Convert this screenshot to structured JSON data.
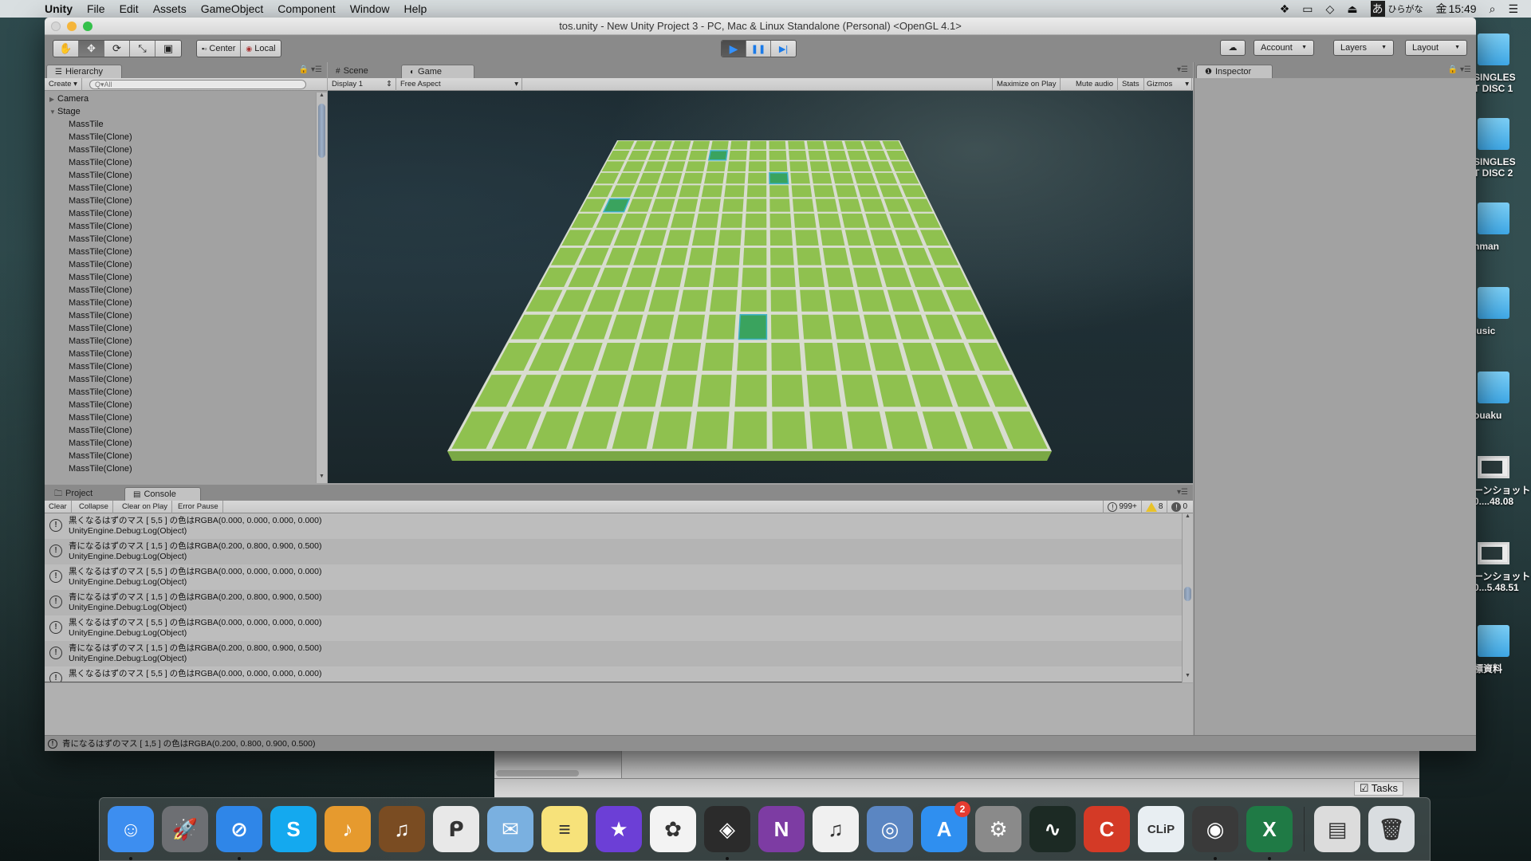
{
  "menubar": {
    "app_name": "Unity",
    "items": [
      "File",
      "Edit",
      "Assets",
      "GameObject",
      "Component",
      "Window",
      "Help"
    ],
    "status": {
      "input_method_glyph": "あ",
      "input_method_label": "ひらがな",
      "day": "金",
      "time": "15:49"
    }
  },
  "window": {
    "title": "tos.unity - New Unity Project 3 - PC, Mac & Linux Standalone (Personal) <OpenGL 4.1>"
  },
  "toolbar": {
    "transform_tools": [
      {
        "name": "hand-tool",
        "glyph": "✋",
        "active": false
      },
      {
        "name": "move-tool",
        "glyph": "✥",
        "active": true
      },
      {
        "name": "rotate-tool",
        "glyph": "⟳",
        "active": false
      },
      {
        "name": "scale-tool",
        "glyph": "⤡",
        "active": false
      },
      {
        "name": "rect-tool",
        "glyph": "▣",
        "active": false
      }
    ],
    "pivot_center_label": "Center",
    "pivot_local_label": "Local",
    "play_glyph": "▶",
    "pause_glyph": "❚❚",
    "step_glyph": "▶|",
    "cloud_glyph": "☁",
    "account_label": "Account",
    "layers_label": "Layers",
    "layout_label": "Layout"
  },
  "hierarchy": {
    "tab_label": "Hierarchy",
    "create_label": "Create",
    "search_placeholder": "Q▾All",
    "items": [
      {
        "label": "Camera",
        "expander": "▶",
        "level": 0
      },
      {
        "label": "Stage",
        "expander": "▼",
        "level": 0
      },
      {
        "label": "MassTile",
        "level": 1
      },
      {
        "label": "MassTile(Clone)",
        "level": 1
      },
      {
        "label": "MassTile(Clone)",
        "level": 1
      },
      {
        "label": "MassTile(Clone)",
        "level": 1
      },
      {
        "label": "MassTile(Clone)",
        "level": 1
      },
      {
        "label": "MassTile(Clone)",
        "level": 1
      },
      {
        "label": "MassTile(Clone)",
        "level": 1
      },
      {
        "label": "MassTile(Clone)",
        "level": 1
      },
      {
        "label": "MassTile(Clone)",
        "level": 1
      },
      {
        "label": "MassTile(Clone)",
        "level": 1
      },
      {
        "label": "MassTile(Clone)",
        "level": 1
      },
      {
        "label": "MassTile(Clone)",
        "level": 1
      },
      {
        "label": "MassTile(Clone)",
        "level": 1
      },
      {
        "label": "MassTile(Clone)",
        "level": 1
      },
      {
        "label": "MassTile(Clone)",
        "level": 1
      },
      {
        "label": "MassTile(Clone)",
        "level": 1
      },
      {
        "label": "MassTile(Clone)",
        "level": 1
      },
      {
        "label": "MassTile(Clone)",
        "level": 1
      },
      {
        "label": "MassTile(Clone)",
        "level": 1
      },
      {
        "label": "MassTile(Clone)",
        "level": 1
      },
      {
        "label": "MassTile(Clone)",
        "level": 1
      },
      {
        "label": "MassTile(Clone)",
        "level": 1
      },
      {
        "label": "MassTile(Clone)",
        "level": 1
      },
      {
        "label": "MassTile(Clone)",
        "level": 1
      },
      {
        "label": "MassTile(Clone)",
        "level": 1
      },
      {
        "label": "MassTile(Clone)",
        "level": 1
      },
      {
        "label": "MassTile(Clone)",
        "level": 1
      },
      {
        "label": "MassTile(Clone)",
        "level": 1
      }
    ]
  },
  "game_view": {
    "tabs": [
      {
        "label": "Scene",
        "icon": "#",
        "active": false
      },
      {
        "label": "Game",
        "icon": "◐",
        "active": true
      }
    ],
    "display_label": "Display 1",
    "aspect_label": "Free Aspect",
    "options": [
      "Maximize on Play",
      "Mute audio",
      "Stats",
      "Gizmos"
    ],
    "board": {
      "columns": 15,
      "rows": 15,
      "tile_color": "#8fc14f",
      "line_color": "#d9ddd0",
      "highlight_color": "#3aa35e",
      "highlight_border": "#3cb3c9",
      "highlighted_cells": [
        {
          "row": 1,
          "col": 5
        },
        {
          "row": 3,
          "col": 8
        },
        {
          "row": 5,
          "col": 1
        },
        {
          "row": 11,
          "col": 7
        }
      ]
    }
  },
  "inspector": {
    "tab_label": "Inspector"
  },
  "console": {
    "tabs": [
      {
        "label": "Project",
        "active": false
      },
      {
        "label": "Console",
        "active": true
      }
    ],
    "buttons": [
      "Clear",
      "Collapse",
      "Clear on Play",
      "Error Pause"
    ],
    "log_count": "999+",
    "warning_count": "8",
    "error_count": "0",
    "entries": [
      {
        "message": "黒くなるはずのマス [ 5,5 ] の色はRGBA(0.000, 0.000, 0.000, 0.000)",
        "trace": "UnityEngine.Debug:Log(Object)"
      },
      {
        "message": "青になるはずのマス [ 1,5 ] の色はRGBA(0.200, 0.800, 0.900, 0.500)",
        "trace": "UnityEngine.Debug:Log(Object)"
      },
      {
        "message": "黒くなるはずのマス [ 5,5 ] の色はRGBA(0.000, 0.000, 0.000, 0.000)",
        "trace": "UnityEngine.Debug:Log(Object)"
      },
      {
        "message": "青になるはずのマス [ 1,5 ] の色はRGBA(0.200, 0.800, 0.900, 0.500)",
        "trace": "UnityEngine.Debug:Log(Object)"
      },
      {
        "message": "黒くなるはずのマス [ 5,5 ] の色はRGBA(0.000, 0.000, 0.000, 0.000)",
        "trace": "UnityEngine.Debug:Log(Object)"
      },
      {
        "message": "青になるはずのマス [ 1,5 ] の色はRGBA(0.200, 0.800, 0.900, 0.500)",
        "trace": "UnityEngine.Debug:Log(Object)"
      },
      {
        "message": "黒くなるはずのマス [ 5,5 ] の色はRGBA(0.000, 0.000, 0.000, 0.000)",
        "trace": ""
      }
    ]
  },
  "status_bar": {
    "message": "青になるはずのマス [ 1,5 ] の色はRGBA(0.200, 0.800, 0.900, 0.500)"
  },
  "background_window": {
    "tasks_label": "Tasks"
  },
  "desktop": {
    "items": [
      {
        "label": "SINGLES\nT DISC 1",
        "type": "folder"
      },
      {
        "label": "SINGLES\nT DISC 2",
        "type": "folder"
      },
      {
        "label": "nman",
        "type": "folder"
      },
      {
        "label": "lusic",
        "type": "folder"
      },
      {
        "label": "ouaku",
        "type": "folder"
      },
      {
        "label": "ーンショット\n0....48.08",
        "type": "screenshot"
      },
      {
        "label": "ーンショット\n0...5.48.51",
        "type": "screenshot"
      },
      {
        "label": "標資料",
        "type": "folder"
      }
    ]
  },
  "dock": {
    "apps": [
      {
        "name": "finder",
        "glyph": "☺",
        "bg": "#3d8ef0",
        "running": true
      },
      {
        "name": "launchpad",
        "glyph": "🚀",
        "bg": "#6d6f73",
        "running": false
      },
      {
        "name": "safari",
        "glyph": "⊘",
        "bg": "#2f86e8",
        "running": true
      },
      {
        "name": "skype",
        "glyph": "S",
        "bg": "#14a9ef",
        "running": false
      },
      {
        "name": "mainstage",
        "glyph": "♪",
        "bg": "#e69a2e",
        "running": false
      },
      {
        "name": "garageband",
        "glyph": "♫",
        "bg": "#7a4c22",
        "running": false
      },
      {
        "name": "clip-studio",
        "glyph": "ᑭ",
        "bg": "#e8e8e8",
        "running": false
      },
      {
        "name": "mail",
        "glyph": "✉",
        "bg": "#7ab0e0",
        "running": false
      },
      {
        "name": "notes",
        "glyph": "≡",
        "bg": "#f7e27a",
        "running": false
      },
      {
        "name": "imovie",
        "glyph": "★",
        "bg": "#6c3fd6",
        "running": false
      },
      {
        "name": "photos",
        "glyph": "✿",
        "bg": "#f3f3f3",
        "running": false
      },
      {
        "name": "unity",
        "glyph": "◈",
        "bg": "#2b2b2b",
        "running": true
      },
      {
        "name": "onenote",
        "glyph": "N",
        "bg": "#7d3ca3",
        "running": false
      },
      {
        "name": "itunes",
        "glyph": "♫",
        "bg": "#f0f0f0",
        "running": false
      },
      {
        "name": "monodevelop",
        "glyph": "◎",
        "bg": "#5b86c2",
        "running": false
      },
      {
        "name": "app-store",
        "glyph": "A",
        "bg": "#2f8ff0",
        "running": false,
        "badge": "2"
      },
      {
        "name": "system-preferences",
        "glyph": "⚙",
        "bg": "#8a8a8a",
        "running": false
      },
      {
        "name": "activity-monitor",
        "glyph": "∿",
        "bg": "#1c2a24",
        "running": false
      },
      {
        "name": "ccleaner",
        "glyph": "C",
        "bg": "#d43a26",
        "running": false
      },
      {
        "name": "clip",
        "glyph": "CLiP",
        "bg": "#e8eef2",
        "running": false
      },
      {
        "name": "wacom",
        "glyph": "◉",
        "bg": "#3a3a3a",
        "running": true
      },
      {
        "name": "excel",
        "glyph": "X",
        "bg": "#1f7a45",
        "running": true
      }
    ],
    "trailing": [
      {
        "name": "safari-minimized-window",
        "glyph": "▤",
        "bg": "#dcdcdc"
      },
      {
        "name": "trash",
        "glyph": "🗑",
        "bg": "#d9dde0"
      }
    ]
  }
}
